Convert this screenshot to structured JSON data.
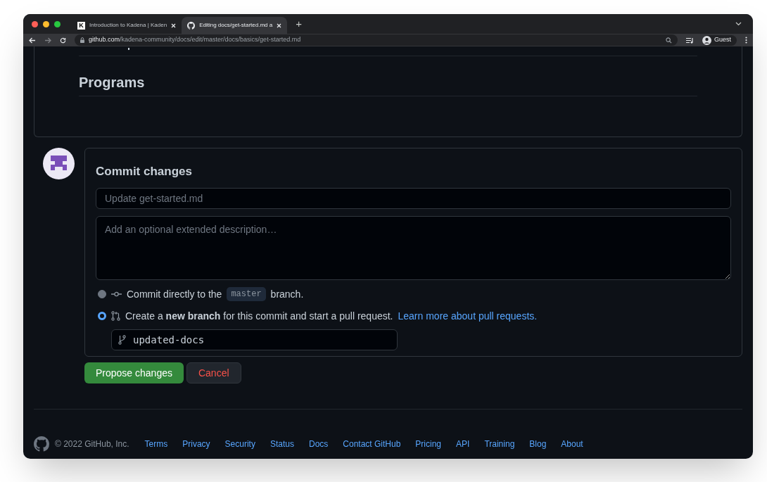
{
  "browser": {
    "tabs": [
      {
        "title": "Introduction to Kadena | Kaden",
        "kind": "letter",
        "favicon_text": "K",
        "selected": false
      },
      {
        "title": "Editing docs/get-started.md a",
        "kind": "github",
        "selected": true
      }
    ],
    "new_tab": "+",
    "url_host": "github.com",
    "url_path": "/kadena-community/docs/edit/master/docs/basics/get-started.md",
    "profile": "Guest"
  },
  "preview": {
    "heading": "Programs"
  },
  "commit": {
    "title": "Commit changes",
    "summary_placeholder": "Update get-started.md",
    "description_placeholder": "Add an optional extended description…",
    "options": [
      {
        "kind": "direct",
        "selected": false,
        "before": "Commit directly to the",
        "code": "master",
        "after": "branch."
      },
      {
        "kind": "new_branch",
        "selected": true,
        "text": "Create a **new branch** for this commit and start a pull request.",
        "link": "Learn more about pull requests."
      }
    ],
    "branch_name": "updated-docs",
    "propose": "Propose changes",
    "cancel": "Cancel"
  },
  "footer": {
    "copyright": "© 2022 GitHub, Inc.",
    "links": [
      "Terms",
      "Privacy",
      "Security",
      "Status",
      "Docs",
      "Contact GitHub",
      "Pricing",
      "API",
      "Training",
      "Blog",
      "About"
    ]
  }
}
